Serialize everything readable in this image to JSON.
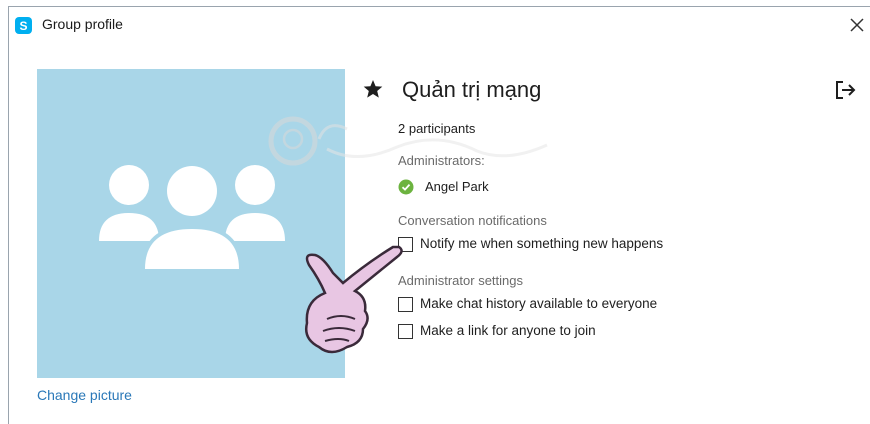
{
  "window": {
    "title": "Group profile"
  },
  "avatar": {
    "change_picture_label": "Change picture"
  },
  "group": {
    "name": "Quản trị mạng",
    "participants": "2 participants"
  },
  "administrators": {
    "label": "Administrators:",
    "list": [
      {
        "name": "Angel Park",
        "status": "online"
      }
    ]
  },
  "conversation_notifications": {
    "label": "Conversation notifications",
    "options": [
      {
        "label": "Notify me when something new happens",
        "checked": false
      }
    ]
  },
  "administrator_settings": {
    "label": "Administrator settings",
    "options": [
      {
        "label": "Make chat history available to everyone",
        "checked": false
      },
      {
        "label": "Make a link for anyone to join",
        "checked": false
      }
    ]
  },
  "colors": {
    "accent": "#2a78b8",
    "avatar_bg": "#a9d6e8",
    "status_online": "#6cb33f",
    "skype_blue": "#00aff0"
  },
  "icons": [
    "skype-logo-icon",
    "close-icon",
    "group-icon",
    "star-icon",
    "leave-group-icon",
    "online-status-icon",
    "pointing-hand-icon",
    "watermark-logo-icon"
  ]
}
